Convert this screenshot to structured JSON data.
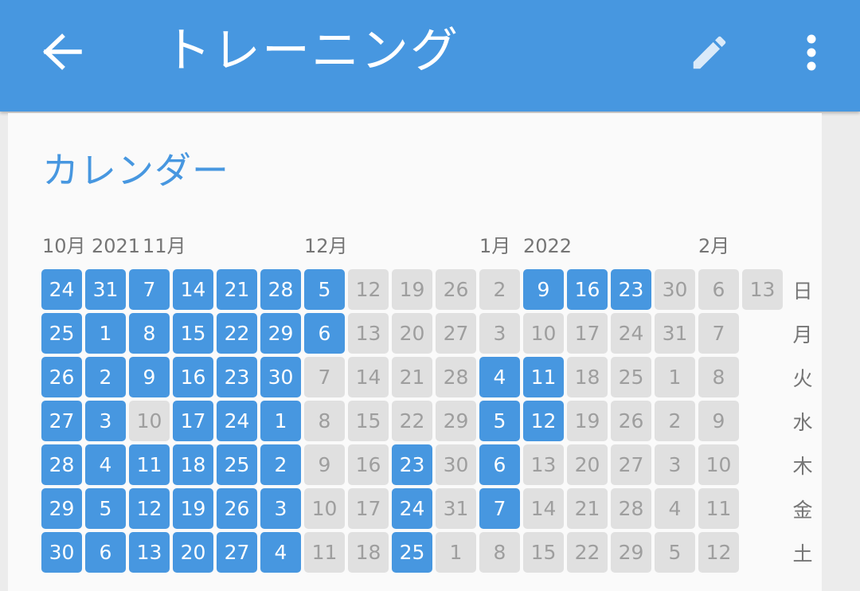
{
  "appbar": {
    "title": "トレーニング",
    "back_icon": "arrow-left-icon",
    "edit_icon": "pencil-icon",
    "more_icon": "more-vert-icon",
    "color": "#4797e0"
  },
  "calendar": {
    "title": "カレンダー",
    "header_labels": [
      "10月",
      "2021",
      "11月",
      "12月",
      "1月",
      "2022",
      "2月"
    ],
    "weekdays": [
      "日",
      "月",
      "火",
      "水",
      "木",
      "金",
      "土"
    ],
    "colors": {
      "active": "#4797e0",
      "inactive": "#e0e0e0"
    },
    "weeks": [
      [
        {
          "d": "24",
          "a": true
        },
        {
          "d": "25",
          "a": true
        },
        {
          "d": "26",
          "a": true
        },
        {
          "d": "27",
          "a": true
        },
        {
          "d": "28",
          "a": true
        },
        {
          "d": "29",
          "a": true
        },
        {
          "d": "30",
          "a": true
        }
      ],
      [
        {
          "d": "31",
          "a": true
        },
        {
          "d": "1",
          "a": true
        },
        {
          "d": "2",
          "a": true
        },
        {
          "d": "3",
          "a": true
        },
        {
          "d": "4",
          "a": true
        },
        {
          "d": "5",
          "a": true
        },
        {
          "d": "6",
          "a": true
        }
      ],
      [
        {
          "d": "7",
          "a": true
        },
        {
          "d": "8",
          "a": true
        },
        {
          "d": "9",
          "a": true
        },
        {
          "d": "10",
          "a": false
        },
        {
          "d": "11",
          "a": true
        },
        {
          "d": "12",
          "a": true
        },
        {
          "d": "13",
          "a": true
        }
      ],
      [
        {
          "d": "14",
          "a": true
        },
        {
          "d": "15",
          "a": true
        },
        {
          "d": "16",
          "a": true
        },
        {
          "d": "17",
          "a": true
        },
        {
          "d": "18",
          "a": true
        },
        {
          "d": "19",
          "a": true
        },
        {
          "d": "20",
          "a": true
        }
      ],
      [
        {
          "d": "21",
          "a": true
        },
        {
          "d": "22",
          "a": true
        },
        {
          "d": "23",
          "a": true
        },
        {
          "d": "24",
          "a": true
        },
        {
          "d": "25",
          "a": true
        },
        {
          "d": "26",
          "a": true
        },
        {
          "d": "27",
          "a": true
        }
      ],
      [
        {
          "d": "28",
          "a": true
        },
        {
          "d": "29",
          "a": true
        },
        {
          "d": "30",
          "a": true
        },
        {
          "d": "1",
          "a": true
        },
        {
          "d": "2",
          "a": true
        },
        {
          "d": "3",
          "a": true
        },
        {
          "d": "4",
          "a": true
        }
      ],
      [
        {
          "d": "5",
          "a": true
        },
        {
          "d": "6",
          "a": true
        },
        {
          "d": "7",
          "a": false
        },
        {
          "d": "8",
          "a": false
        },
        {
          "d": "9",
          "a": false
        },
        {
          "d": "10",
          "a": false
        },
        {
          "d": "11",
          "a": false
        }
      ],
      [
        {
          "d": "12",
          "a": false
        },
        {
          "d": "13",
          "a": false
        },
        {
          "d": "14",
          "a": false
        },
        {
          "d": "15",
          "a": false
        },
        {
          "d": "16",
          "a": false
        },
        {
          "d": "17",
          "a": false
        },
        {
          "d": "18",
          "a": false
        }
      ],
      [
        {
          "d": "19",
          "a": false
        },
        {
          "d": "20",
          "a": false
        },
        {
          "d": "21",
          "a": false
        },
        {
          "d": "22",
          "a": false
        },
        {
          "d": "23",
          "a": true
        },
        {
          "d": "24",
          "a": true
        },
        {
          "d": "25",
          "a": true
        }
      ],
      [
        {
          "d": "26",
          "a": false
        },
        {
          "d": "27",
          "a": false
        },
        {
          "d": "28",
          "a": false
        },
        {
          "d": "29",
          "a": false
        },
        {
          "d": "30",
          "a": false
        },
        {
          "d": "31",
          "a": false
        },
        {
          "d": "1",
          "a": false
        }
      ],
      [
        {
          "d": "2",
          "a": false
        },
        {
          "d": "3",
          "a": false
        },
        {
          "d": "4",
          "a": true
        },
        {
          "d": "5",
          "a": true
        },
        {
          "d": "6",
          "a": true
        },
        {
          "d": "7",
          "a": true
        },
        {
          "d": "8",
          "a": false
        }
      ],
      [
        {
          "d": "9",
          "a": true
        },
        {
          "d": "10",
          "a": false
        },
        {
          "d": "11",
          "a": true
        },
        {
          "d": "12",
          "a": true
        },
        {
          "d": "13",
          "a": false
        },
        {
          "d": "14",
          "a": false
        },
        {
          "d": "15",
          "a": false
        }
      ],
      [
        {
          "d": "16",
          "a": true
        },
        {
          "d": "17",
          "a": false
        },
        {
          "d": "18",
          "a": false
        },
        {
          "d": "19",
          "a": false
        },
        {
          "d": "20",
          "a": false
        },
        {
          "d": "21",
          "a": false
        },
        {
          "d": "22",
          "a": false
        }
      ],
      [
        {
          "d": "23",
          "a": true
        },
        {
          "d": "24",
          "a": false
        },
        {
          "d": "25",
          "a": false
        },
        {
          "d": "26",
          "a": false
        },
        {
          "d": "27",
          "a": false
        },
        {
          "d": "28",
          "a": false
        },
        {
          "d": "29",
          "a": false
        }
      ],
      [
        {
          "d": "30",
          "a": false
        },
        {
          "d": "31",
          "a": false
        },
        {
          "d": "1",
          "a": false
        },
        {
          "d": "2",
          "a": false
        },
        {
          "d": "3",
          "a": false
        },
        {
          "d": "4",
          "a": false
        },
        {
          "d": "5",
          "a": false
        }
      ],
      [
        {
          "d": "6",
          "a": false
        },
        {
          "d": "7",
          "a": false
        },
        {
          "d": "8",
          "a": false
        },
        {
          "d": "9",
          "a": false
        },
        {
          "d": "10",
          "a": false
        },
        {
          "d": "11",
          "a": false
        },
        {
          "d": "12",
          "a": false
        }
      ],
      [
        {
          "d": "13",
          "a": false
        }
      ]
    ]
  }
}
